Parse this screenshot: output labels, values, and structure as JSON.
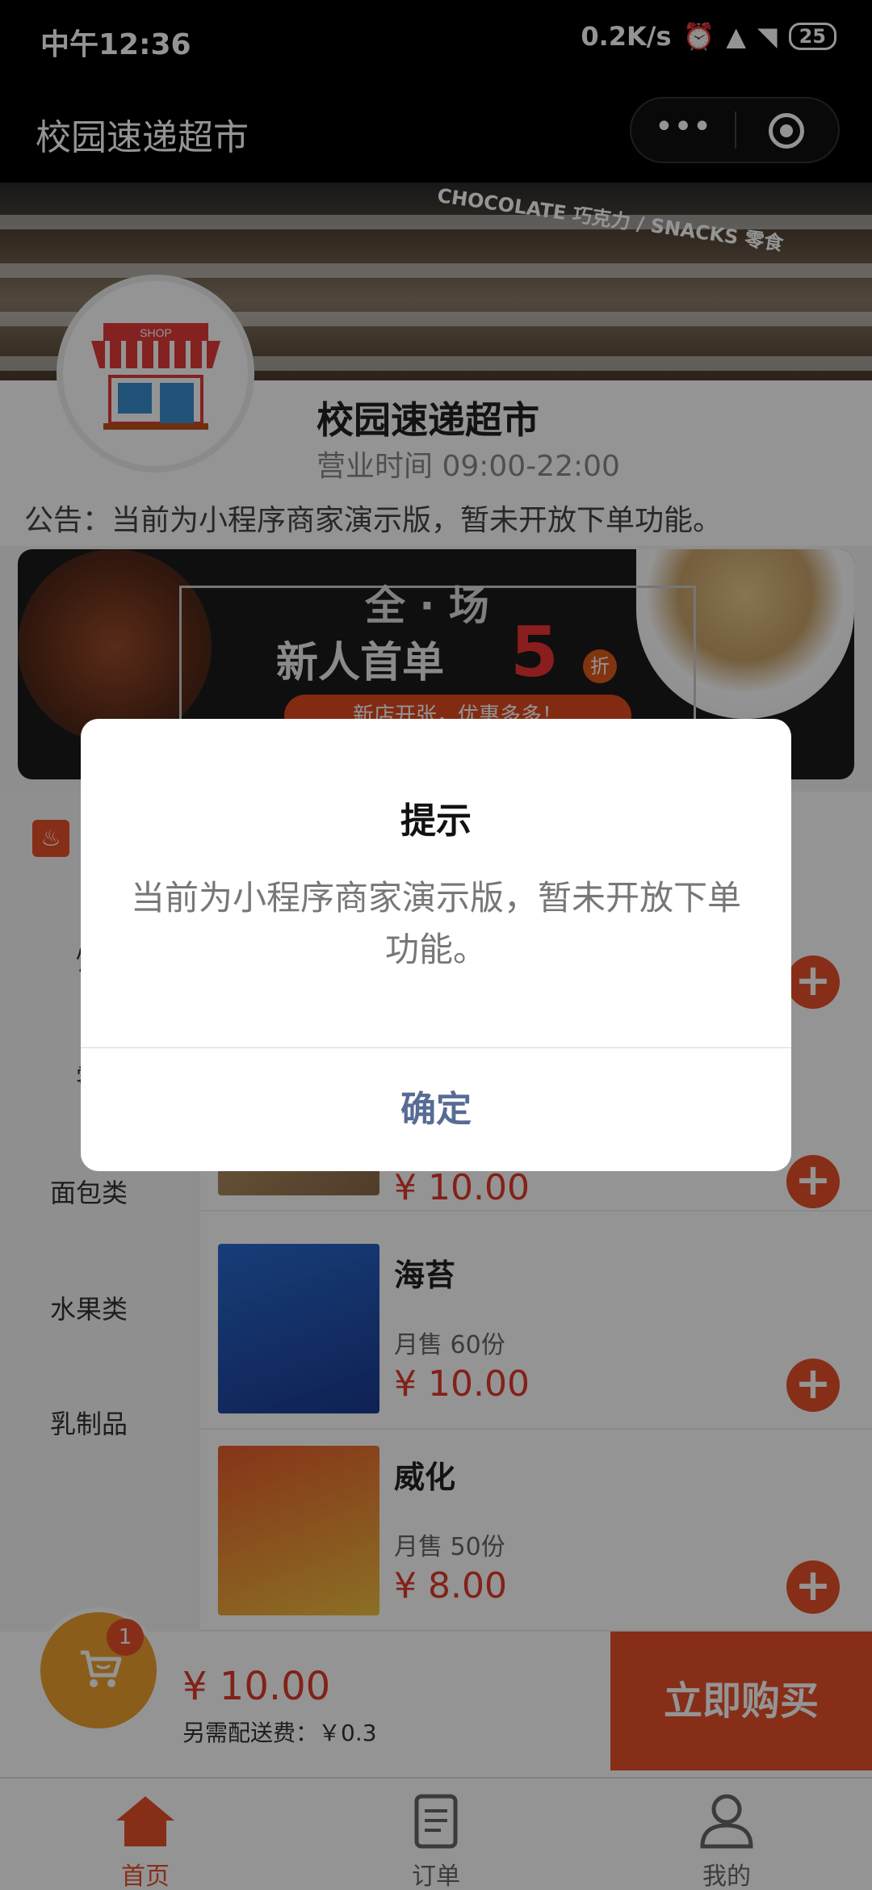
{
  "status": {
    "time": "中午12:36",
    "speed": "0.2K/s",
    "battery": "25"
  },
  "nav": {
    "title": "校园速递超市",
    "more": "•••"
  },
  "banner": {
    "sign": "CHOCOLATE 巧克力 / SNACKS 零食"
  },
  "shop": {
    "logo_text": "SHOP",
    "name": "校园速递超市",
    "hours": "营业时间 09:00-22:00",
    "notice": "公告：当前为小程序商家演示版，暂未开放下单功能。"
  },
  "promo": {
    "line1": "全 · 场",
    "line2": "新人首单",
    "discount": "5",
    "discount_unit": "折",
    "tag": "新店开张，优惠多多！"
  },
  "categories": [
    "饮",
    "零",
    "面包类",
    "水果类",
    "乳制品"
  ],
  "products": [
    {
      "name": "海苔",
      "sales": "月售 60份",
      "price": "¥ 10.00"
    },
    {
      "name": "威化",
      "sales": "月售 50份",
      "price": "¥ 8.00"
    }
  ],
  "partial_product": {
    "price": "¥ 10.00"
  },
  "cart": {
    "badge": "1",
    "total": "¥ 10.00",
    "fee": "另需配送费：￥0.3",
    "buy_label": "立即购买"
  },
  "tabs": [
    {
      "label": "首页",
      "icon": "home-icon"
    },
    {
      "label": "订单",
      "icon": "order-icon"
    },
    {
      "label": "我的",
      "icon": "user-icon"
    }
  ],
  "dialog": {
    "title": "提示",
    "message": "当前为小程序商家演示版，暂未开放下单功能。",
    "confirm": "确定"
  },
  "colors": {
    "accent": "#e8502a",
    "price": "#e03a2a",
    "confirm": "#576b95",
    "cart": "#f0a030"
  }
}
